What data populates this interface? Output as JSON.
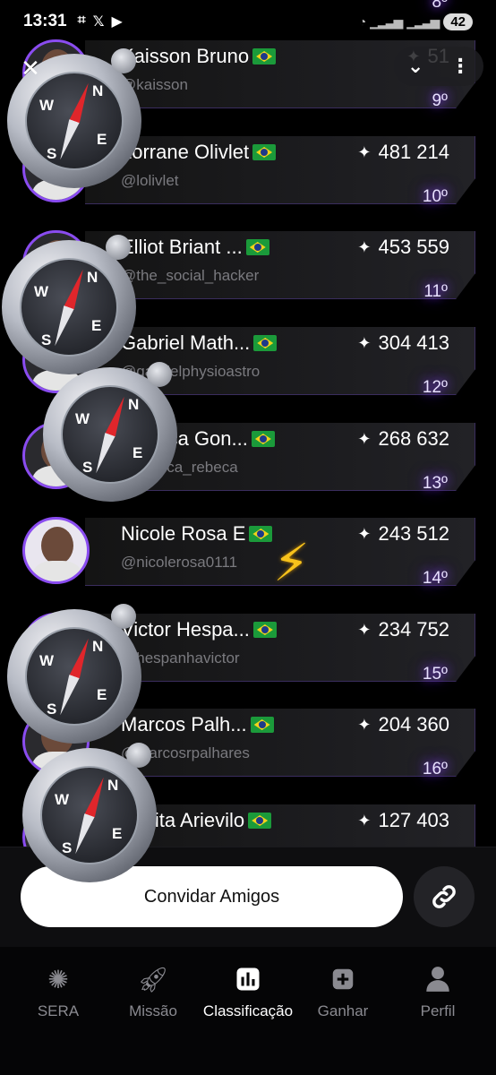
{
  "status_bar": {
    "time": "13:31",
    "left_icons": [
      "screenshot-icon",
      "x-icon",
      "youtube-icon"
    ],
    "battery": "42"
  },
  "top_controls": {
    "close_icon": "close-icon",
    "collapse_icon": "chevron-down-icon",
    "more_icon": "more-vertical-icon"
  },
  "ranking": [
    {
      "name": "Kaisson Bruno",
      "handle": "@kaisson",
      "score": "51",
      "rank": "9º"
    },
    {
      "name": "Lorrane Olivlet",
      "handle": "@lolivlet",
      "score": "481 214",
      "rank": "10º"
    },
    {
      "name": "Elliot Briant ...",
      "handle": "@the_social_hacker",
      "score": "453 559",
      "rank": "11º"
    },
    {
      "name": "Gabriel Math...",
      "handle": "@gabrielphysioastro",
      "score": "304 413",
      "rank": "12º"
    },
    {
      "name": "Rebeca Gon...",
      "handle": "@rebeca_rebeca",
      "score": "268 632",
      "rank": "13º"
    },
    {
      "name": "Nicole Rosa E",
      "handle": "@nicolerosa0111",
      "score": "243 512",
      "rank": "14º"
    },
    {
      "name": "Victor Hespa...",
      "handle": "@hespanhavictor",
      "score": "234 752",
      "rank": "15º"
    },
    {
      "name": "Marcos Palh...",
      "handle": "@marcosrpalhares",
      "score": "204 360",
      "rank": "16º"
    },
    {
      "name": "Marita Arievilo",
      "handle": "",
      "score": "127 403",
      "rank": ""
    }
  ],
  "previous_rank_partial": "8º",
  "invite_button": "Convidar Amigos",
  "link_icon": "link-icon",
  "tabs": [
    {
      "label": "SERA",
      "icon": "sera-logo-icon"
    },
    {
      "label": "Missão",
      "icon": "rocket-icon"
    },
    {
      "label": "Classificação",
      "icon": "leaderboard-icon",
      "active": true
    },
    {
      "label": "Ganhar",
      "icon": "gift-icon"
    },
    {
      "label": "Perfil",
      "icon": "user-icon"
    }
  ],
  "colors": {
    "accent": "#8a4cf0",
    "background": "#000000",
    "button": "#ffffff"
  }
}
